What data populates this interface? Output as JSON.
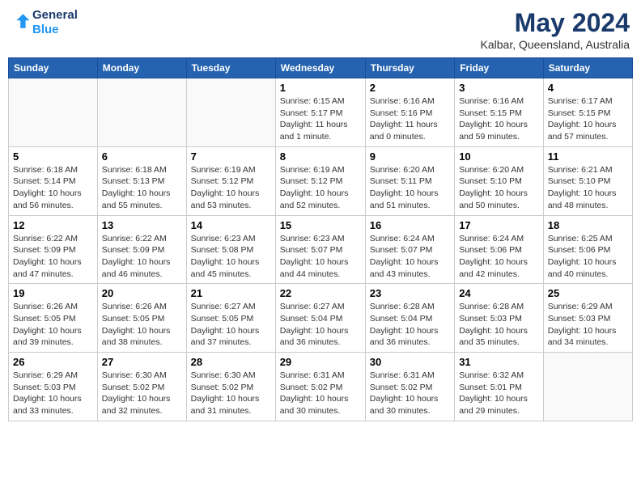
{
  "logo": {
    "line1": "General",
    "line2": "Blue"
  },
  "title": "May 2024",
  "subtitle": "Kalbar, Queensland, Australia",
  "days_header": [
    "Sunday",
    "Monday",
    "Tuesday",
    "Wednesday",
    "Thursday",
    "Friday",
    "Saturday"
  ],
  "weeks": [
    [
      {
        "day": "",
        "info": ""
      },
      {
        "day": "",
        "info": ""
      },
      {
        "day": "",
        "info": ""
      },
      {
        "day": "1",
        "info": "Sunrise: 6:15 AM\nSunset: 5:17 PM\nDaylight: 11 hours\nand 1 minute."
      },
      {
        "day": "2",
        "info": "Sunrise: 6:16 AM\nSunset: 5:16 PM\nDaylight: 11 hours\nand 0 minutes."
      },
      {
        "day": "3",
        "info": "Sunrise: 6:16 AM\nSunset: 5:15 PM\nDaylight: 10 hours\nand 59 minutes."
      },
      {
        "day": "4",
        "info": "Sunrise: 6:17 AM\nSunset: 5:15 PM\nDaylight: 10 hours\nand 57 minutes."
      }
    ],
    [
      {
        "day": "5",
        "info": "Sunrise: 6:18 AM\nSunset: 5:14 PM\nDaylight: 10 hours\nand 56 minutes."
      },
      {
        "day": "6",
        "info": "Sunrise: 6:18 AM\nSunset: 5:13 PM\nDaylight: 10 hours\nand 55 minutes."
      },
      {
        "day": "7",
        "info": "Sunrise: 6:19 AM\nSunset: 5:12 PM\nDaylight: 10 hours\nand 53 minutes."
      },
      {
        "day": "8",
        "info": "Sunrise: 6:19 AM\nSunset: 5:12 PM\nDaylight: 10 hours\nand 52 minutes."
      },
      {
        "day": "9",
        "info": "Sunrise: 6:20 AM\nSunset: 5:11 PM\nDaylight: 10 hours\nand 51 minutes."
      },
      {
        "day": "10",
        "info": "Sunrise: 6:20 AM\nSunset: 5:10 PM\nDaylight: 10 hours\nand 50 minutes."
      },
      {
        "day": "11",
        "info": "Sunrise: 6:21 AM\nSunset: 5:10 PM\nDaylight: 10 hours\nand 48 minutes."
      }
    ],
    [
      {
        "day": "12",
        "info": "Sunrise: 6:22 AM\nSunset: 5:09 PM\nDaylight: 10 hours\nand 47 minutes."
      },
      {
        "day": "13",
        "info": "Sunrise: 6:22 AM\nSunset: 5:09 PM\nDaylight: 10 hours\nand 46 minutes."
      },
      {
        "day": "14",
        "info": "Sunrise: 6:23 AM\nSunset: 5:08 PM\nDaylight: 10 hours\nand 45 minutes."
      },
      {
        "day": "15",
        "info": "Sunrise: 6:23 AM\nSunset: 5:07 PM\nDaylight: 10 hours\nand 44 minutes."
      },
      {
        "day": "16",
        "info": "Sunrise: 6:24 AM\nSunset: 5:07 PM\nDaylight: 10 hours\nand 43 minutes."
      },
      {
        "day": "17",
        "info": "Sunrise: 6:24 AM\nSunset: 5:06 PM\nDaylight: 10 hours\nand 42 minutes."
      },
      {
        "day": "18",
        "info": "Sunrise: 6:25 AM\nSunset: 5:06 PM\nDaylight: 10 hours\nand 40 minutes."
      }
    ],
    [
      {
        "day": "19",
        "info": "Sunrise: 6:26 AM\nSunset: 5:05 PM\nDaylight: 10 hours\nand 39 minutes."
      },
      {
        "day": "20",
        "info": "Sunrise: 6:26 AM\nSunset: 5:05 PM\nDaylight: 10 hours\nand 38 minutes."
      },
      {
        "day": "21",
        "info": "Sunrise: 6:27 AM\nSunset: 5:05 PM\nDaylight: 10 hours\nand 37 minutes."
      },
      {
        "day": "22",
        "info": "Sunrise: 6:27 AM\nSunset: 5:04 PM\nDaylight: 10 hours\nand 36 minutes."
      },
      {
        "day": "23",
        "info": "Sunrise: 6:28 AM\nSunset: 5:04 PM\nDaylight: 10 hours\nand 36 minutes."
      },
      {
        "day": "24",
        "info": "Sunrise: 6:28 AM\nSunset: 5:03 PM\nDaylight: 10 hours\nand 35 minutes."
      },
      {
        "day": "25",
        "info": "Sunrise: 6:29 AM\nSunset: 5:03 PM\nDaylight: 10 hours\nand 34 minutes."
      }
    ],
    [
      {
        "day": "26",
        "info": "Sunrise: 6:29 AM\nSunset: 5:03 PM\nDaylight: 10 hours\nand 33 minutes."
      },
      {
        "day": "27",
        "info": "Sunrise: 6:30 AM\nSunset: 5:02 PM\nDaylight: 10 hours\nand 32 minutes."
      },
      {
        "day": "28",
        "info": "Sunrise: 6:30 AM\nSunset: 5:02 PM\nDaylight: 10 hours\nand 31 minutes."
      },
      {
        "day": "29",
        "info": "Sunrise: 6:31 AM\nSunset: 5:02 PM\nDaylight: 10 hours\nand 30 minutes."
      },
      {
        "day": "30",
        "info": "Sunrise: 6:31 AM\nSunset: 5:02 PM\nDaylight: 10 hours\nand 30 minutes."
      },
      {
        "day": "31",
        "info": "Sunrise: 6:32 AM\nSunset: 5:01 PM\nDaylight: 10 hours\nand 29 minutes."
      },
      {
        "day": "",
        "info": ""
      }
    ]
  ]
}
